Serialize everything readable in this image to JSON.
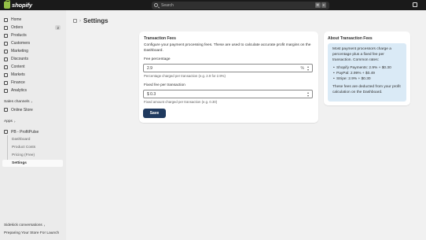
{
  "topbar": {
    "logo_text": "shopify",
    "search_placeholder": "Search",
    "shortcut_keys": [
      "⌘",
      "K"
    ]
  },
  "sidebar": {
    "nav": [
      {
        "label": "Home",
        "icon": "home-icon"
      },
      {
        "label": "Orders",
        "icon": "orders-icon",
        "badge": "2"
      },
      {
        "label": "Products",
        "icon": "products-icon"
      },
      {
        "label": "Customers",
        "icon": "customers-icon"
      },
      {
        "label": "Marketing",
        "icon": "marketing-icon"
      },
      {
        "label": "Discounts",
        "icon": "discounts-icon"
      },
      {
        "label": "Content",
        "icon": "content-icon"
      },
      {
        "label": "Markets",
        "icon": "markets-icon"
      },
      {
        "label": "Finance",
        "icon": "finance-icon"
      },
      {
        "label": "Analytics",
        "icon": "analytics-icon"
      }
    ],
    "sales_channels_label": "Sales channels",
    "online_store_label": "Online Store",
    "apps_label": "Apps",
    "app_name": "PB - ProfitPulse",
    "app_subitems": [
      "Dashboard",
      "Product Costs",
      "Pricing (Free)",
      "Settings"
    ],
    "sidekick_label": "Sidekick conversations",
    "sidekick_item": "Preparing Your Store For Launch"
  },
  "page": {
    "title": "Settings"
  },
  "form": {
    "card_title": "Transaction Fees",
    "description": "Configure your payment processing fees. These are used to calculate accurate profit margins on the Dashboard.",
    "percentage_label": "Fee percentage",
    "percentage_value": "2.9",
    "percentage_suffix": "%",
    "percentage_help": "Percentage charged per transaction (e.g. 2.9 for 2.9%)",
    "fixed_label": "Fixed fee per transaction",
    "fixed_value": "$ 0.3",
    "fixed_help": "Fixed amount charged per transaction (e.g. 0.30)",
    "save_label": "Save"
  },
  "about": {
    "title": "About Transaction Fees",
    "intro": "Most payment processors charge a percentage plus a fixed fee per transaction. Common rates:",
    "rates": [
      "Shopify Payments: 2.9% + $0.30",
      "PayPal: 2.99% + $0.49",
      "Stripe: 2.9% + $0.30"
    ],
    "footer": "These fees are deducted from your profit calculation on the Dashboard."
  },
  "colors": {
    "topbar": "#1a1a1a",
    "sidebar": "#ebebeb",
    "background": "#f1f1f1",
    "primary_button": "#1f3a5f",
    "info_box": "#daeaf6",
    "logo_green": "#95bf47"
  }
}
